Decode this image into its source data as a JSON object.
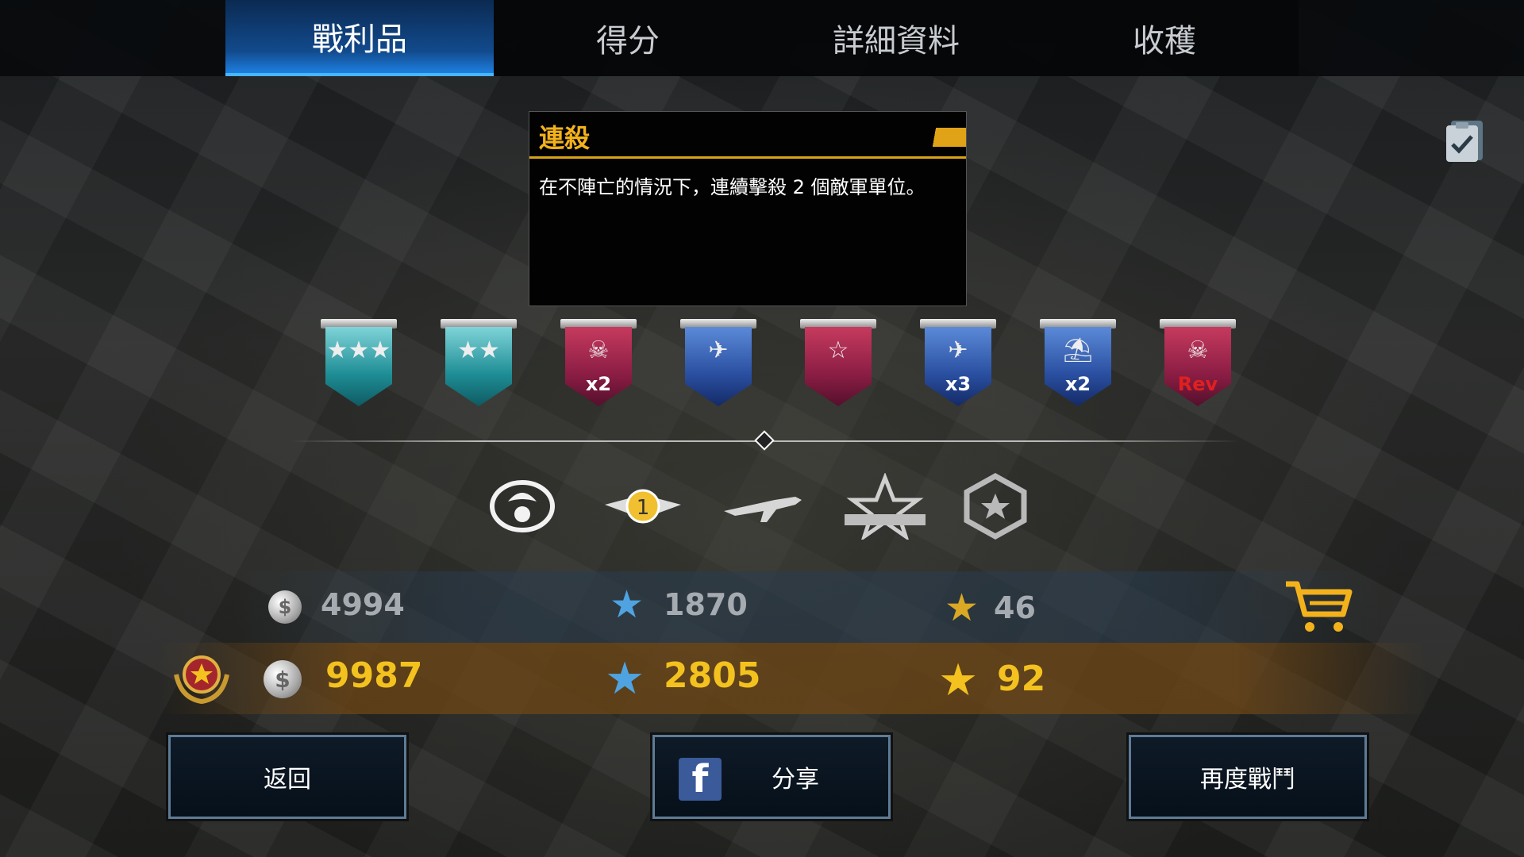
{
  "tabs": [
    {
      "label": "戰利品",
      "active": true
    },
    {
      "label": "得分",
      "active": false
    },
    {
      "label": "詳細資料",
      "active": false
    },
    {
      "label": "收穫",
      "active": false
    }
  ],
  "tooltip": {
    "title": "連殺",
    "description": "在不陣亡的情況下，連續擊殺 2 個敵軍單位。"
  },
  "medals": [
    {
      "icon": "three-stars-icon",
      "color": "teal",
      "glyph": "★★★",
      "multiplier": ""
    },
    {
      "icon": "two-stars-icon",
      "color": "teal",
      "glyph": "★★",
      "multiplier": ""
    },
    {
      "icon": "skull-icon",
      "color": "red",
      "glyph": "☠",
      "multiplier": "x2"
    },
    {
      "icon": "plane-icon",
      "color": "blue",
      "glyph": "✈",
      "multiplier": ""
    },
    {
      "icon": "star-icon",
      "color": "red",
      "glyph": "☆",
      "multiplier": ""
    },
    {
      "icon": "plane-icon",
      "color": "blue",
      "glyph": "✈",
      "multiplier": "x3"
    },
    {
      "icon": "parachute-icon",
      "color": "blue",
      "glyph": "⛱",
      "multiplier": "x2"
    },
    {
      "icon": "skull-revenge-icon",
      "color": "red",
      "glyph": "☠",
      "multiplier": "Rev"
    }
  ],
  "rank_icons": [
    "helmet-emblem-icon",
    "winged-badge-icon",
    "plane-silhouette-icon",
    "star-ribbon-icon",
    "hexagon-star-icon"
  ],
  "currency_base": {
    "silver": "4994",
    "blue_star": "1870",
    "gold_star": "46"
  },
  "currency_total": {
    "silver": "9987",
    "blue_star": "2805",
    "gold_star": "92"
  },
  "buttons": {
    "back": "返回",
    "share": "分享",
    "fight_again": "再度戰鬥"
  },
  "colors": {
    "accent_blue": "#1d7fe0",
    "gold": "#f3c21f",
    "tooltip_title": "#f3b21c"
  }
}
